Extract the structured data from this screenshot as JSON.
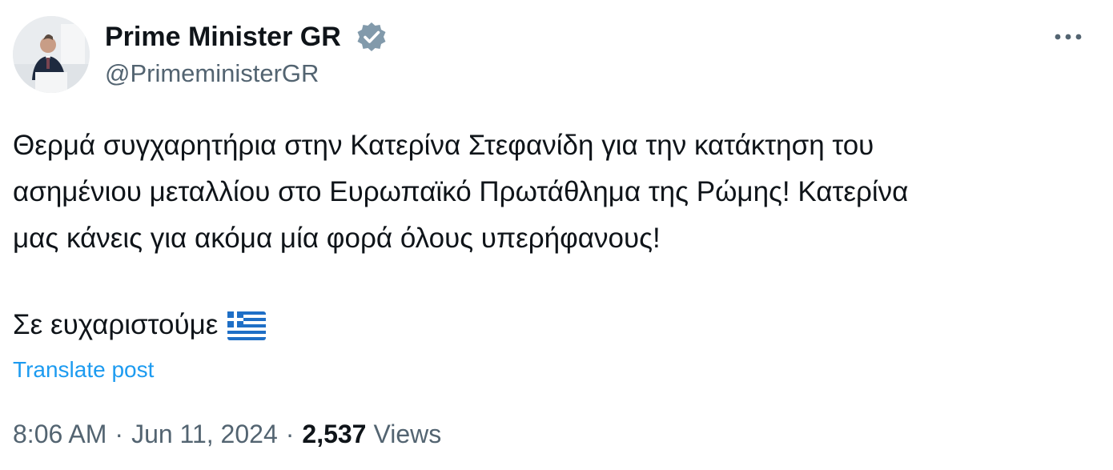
{
  "author": {
    "name": "Prime Minister GR",
    "handle": "@PrimeministerGR",
    "verified_icon": "verified-badge-icon",
    "verified_color": "#829aab"
  },
  "post": {
    "lines": [
      "Θερμά συγχαρητήρια στην Κατερίνα Στεφανίδη για την κατάκτηση του",
      "ασημένιου μεταλλίου στο Ευρωπαϊκό Πρωτάθλημα της Ρώμης! Κατερίνα",
      "μας κάνεις για ακόμα μία φορά όλους υπερήφανους!"
    ],
    "closing": "Σε ευχαριστούμε",
    "closing_emoji": "greek-flag-icon",
    "translate_label": "Translate post"
  },
  "meta": {
    "time": "8:06 AM",
    "separator": "·",
    "date": "Jun 11, 2024",
    "views_count": "2,537",
    "views_label": "Views"
  },
  "actions": {
    "more_icon": "more-options-icon"
  },
  "colors": {
    "text": "#0f1419",
    "secondary": "#536471",
    "link": "#1d9bf0",
    "flag_blue": "#1f6fc6"
  }
}
